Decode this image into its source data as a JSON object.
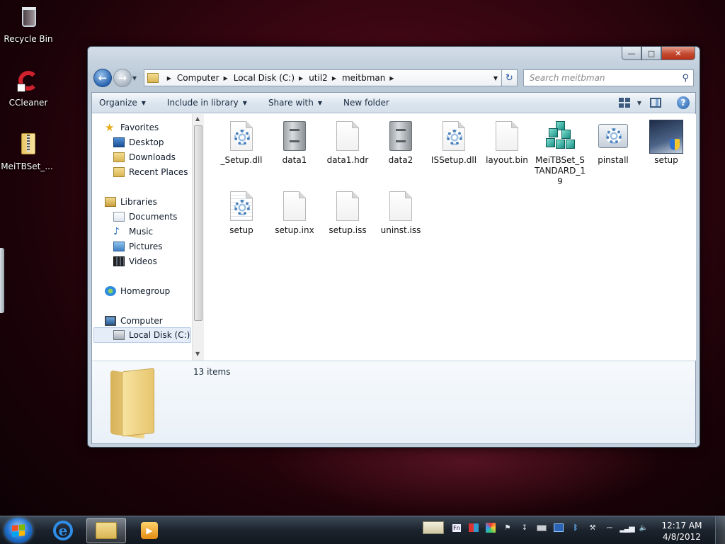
{
  "desktop": {
    "icons": [
      {
        "label": "Recycle Bin",
        "icon": "recycle-bin-icon"
      },
      {
        "label": "CCleaner",
        "icon": "ccleaner-icon"
      },
      {
        "label": "MeiTBSet_...",
        "icon": "zip-folder-icon"
      }
    ]
  },
  "window": {
    "caption_buttons": {
      "minimize": "—",
      "maximize": "□",
      "close": "✕"
    },
    "address": {
      "crumbs": [
        "Computer",
        "Local Disk (C:)",
        "util2",
        "meitbman"
      ]
    },
    "search": {
      "placeholder": "Search meitbman"
    },
    "toolbar": {
      "organize": "Organize",
      "include_in_library": "Include in library",
      "share_with": "Share with",
      "new_folder": "New folder"
    },
    "nav_pane": {
      "favorites": "Favorites",
      "desktop": "Desktop",
      "downloads": "Downloads",
      "recent_places": "Recent Places",
      "libraries": "Libraries",
      "documents": "Documents",
      "music": "Music",
      "pictures": "Pictures",
      "videos": "Videos",
      "homegroup": "Homegroup",
      "computer": "Computer",
      "local_disk": "Local Disk (C:)"
    },
    "files": [
      {
        "name": "_Setup.dll",
        "icon": "dll-gear-icon"
      },
      {
        "name": "data1",
        "icon": "cabinet-icon"
      },
      {
        "name": "data1.hdr",
        "icon": "blank-file-icon"
      },
      {
        "name": "data2",
        "icon": "cabinet-icon"
      },
      {
        "name": "ISSetup.dll",
        "icon": "dll-gear-icon"
      },
      {
        "name": "layout.bin",
        "icon": "blank-file-icon"
      },
      {
        "name": "MeiTBSet_STANDARD_19",
        "icon": "registry-icon"
      },
      {
        "name": "pinstall",
        "icon": "settings-file-icon"
      },
      {
        "name": "setup",
        "icon": "setup-shield-icon"
      },
      {
        "name": "setup",
        "icon": "config-gear-icon"
      },
      {
        "name": "setup.inx",
        "icon": "blank-file-icon"
      },
      {
        "name": "setup.iss",
        "icon": "blank-file-icon"
      },
      {
        "name": "uninst.iss",
        "icon": "blank-file-icon"
      }
    ],
    "details": {
      "item_count": "13 items"
    }
  },
  "taskbar": {
    "clock": {
      "time": "12:17 AM",
      "date": "4/8/2012"
    },
    "tray_icons": [
      "pen-tablet-icon",
      "fn-key-icon",
      "network-adapter-icon",
      "color-tool-icon",
      "flag-icon",
      "usb-icon",
      "drive-icon",
      "display-icon",
      "bluetooth-icon",
      "tools-icon",
      "power-icon",
      "signal-icon",
      "volume-icon"
    ],
    "apps": [
      "start-button",
      "internet-explorer",
      "windows-explorer",
      "media-player"
    ]
  }
}
